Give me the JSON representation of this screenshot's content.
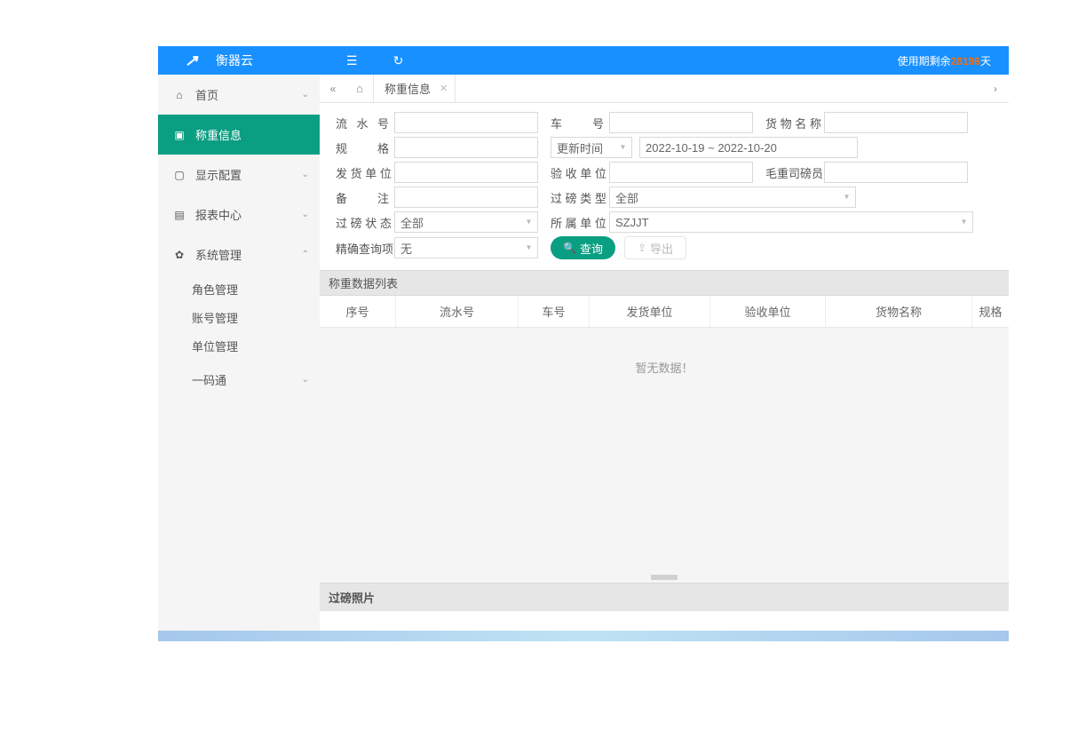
{
  "header": {
    "app_name": "衡器云",
    "expiry_prefix": "使用期剩余",
    "expiry_days": "28196",
    "expiry_suffix": "天"
  },
  "sidebar": {
    "items": [
      {
        "label": "首页",
        "icon": "⌂"
      },
      {
        "label": "称重信息",
        "icon": "▣"
      },
      {
        "label": "显示配置",
        "icon": "▢"
      },
      {
        "label": "报表中心",
        "icon": "▤"
      },
      {
        "label": "系统管理",
        "icon": "✿"
      }
    ],
    "subs": [
      {
        "label": "角色管理"
      },
      {
        "label": "账号管理"
      },
      {
        "label": "单位管理"
      }
    ],
    "more": {
      "label": "一码通"
    }
  },
  "tabs": {
    "active": "称重信息"
  },
  "filters": {
    "serial": {
      "label": "流 水 号"
    },
    "car": {
      "label": "车　　号"
    },
    "goods": {
      "label": "货 物 名 称"
    },
    "spec": {
      "label": "规　　格"
    },
    "time_type": {
      "label": "更新时间"
    },
    "date_range": {
      "value": "2022-10-19 ~ 2022-10-20"
    },
    "shipper": {
      "label": "发 货 单 位"
    },
    "receiver": {
      "label": "验 收 单 位"
    },
    "gross_op": {
      "label": "毛重司磅员"
    },
    "remark": {
      "label": "备　　注"
    },
    "weigh_type": {
      "label": "过 磅 类 型",
      "value": "全部"
    },
    "weigh_status": {
      "label": "过 磅 状 态",
      "value": "全部"
    },
    "owner": {
      "label": "所 属 单 位",
      "value": "SZJJT"
    },
    "precise": {
      "label": "精确查询项",
      "value": "无"
    },
    "search_btn": "查询",
    "export_btn": "导出"
  },
  "table": {
    "title": "称重数据列表",
    "columns": [
      "序号",
      "流水号",
      "车号",
      "发货单位",
      "验收单位",
      "货物名称",
      "规格"
    ],
    "empty": "暂无数据！"
  },
  "photo": {
    "title": "过磅照片"
  }
}
